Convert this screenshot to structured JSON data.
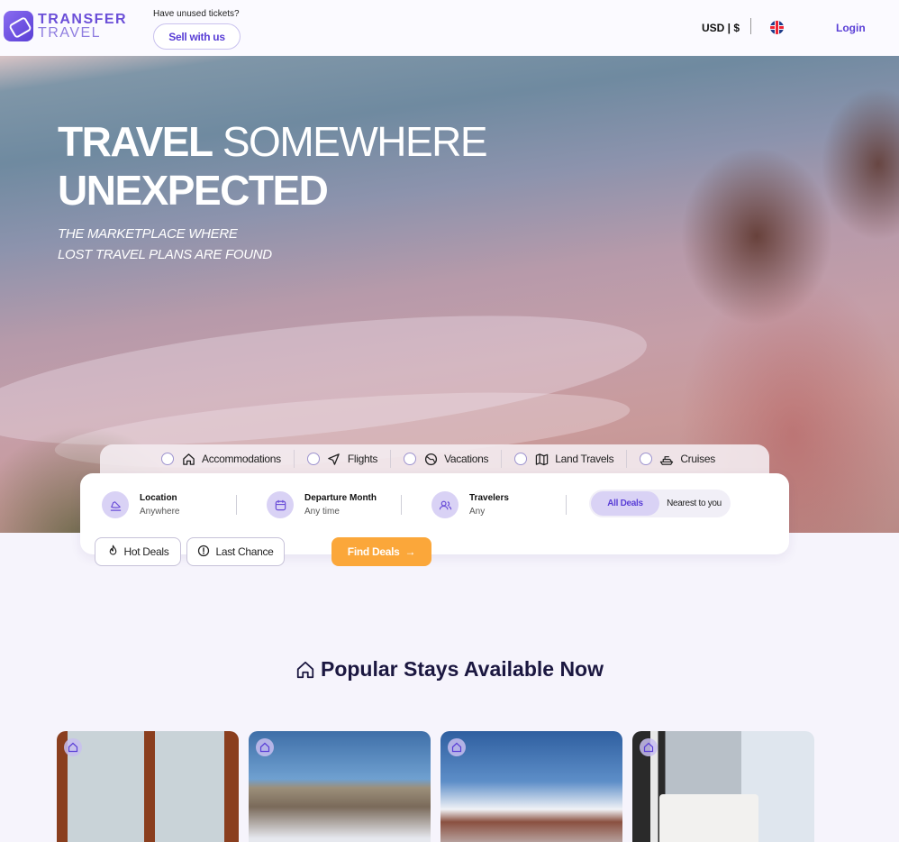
{
  "header": {
    "logo_line1": "TRANSFER",
    "logo_line2": "TRAVEL",
    "unused_text": "Have unused tickets?",
    "sell_label": "Sell with us",
    "currency": "USD | $",
    "language_icon": "uk-flag-icon",
    "login_label": "Login"
  },
  "hero": {
    "headline_bold_1": "TRAVEL",
    "headline_light": "SOMEWHERE",
    "headline_bold_2": "UNEXPECTED",
    "sub_line1": "THE MARKETPLACE WHERE",
    "sub_line2": "LOST TRAVEL PLANS ARE FOUND"
  },
  "categories": [
    {
      "label": "Accommodations",
      "icon": "home-icon"
    },
    {
      "label": "Flights",
      "icon": "plane-icon"
    },
    {
      "label": "Vacations",
      "icon": "globe-icon"
    },
    {
      "label": "Land Travels",
      "icon": "map-icon"
    },
    {
      "label": "Cruises",
      "icon": "ship-icon"
    }
  ],
  "search": {
    "location": {
      "title": "Location",
      "value": "Anywhere",
      "icon": "landing-icon"
    },
    "departure": {
      "title": "Departure Month",
      "value": "Any time",
      "icon": "calendar-icon"
    },
    "travelers": {
      "title": "Travelers",
      "value": "Any",
      "icon": "users-icon"
    },
    "toggle_on": "All Deals",
    "toggle_off": "Nearest to you"
  },
  "filters": {
    "hot_deals": "Hot Deals",
    "last_chance": "Last Chance",
    "find_deals": "Find Deals"
  },
  "section": {
    "title": "Popular Stays Available Now"
  },
  "colors": {
    "brand": "#5a3fd6",
    "accent_orange": "#fba73a",
    "background": "#f6f4fc"
  }
}
